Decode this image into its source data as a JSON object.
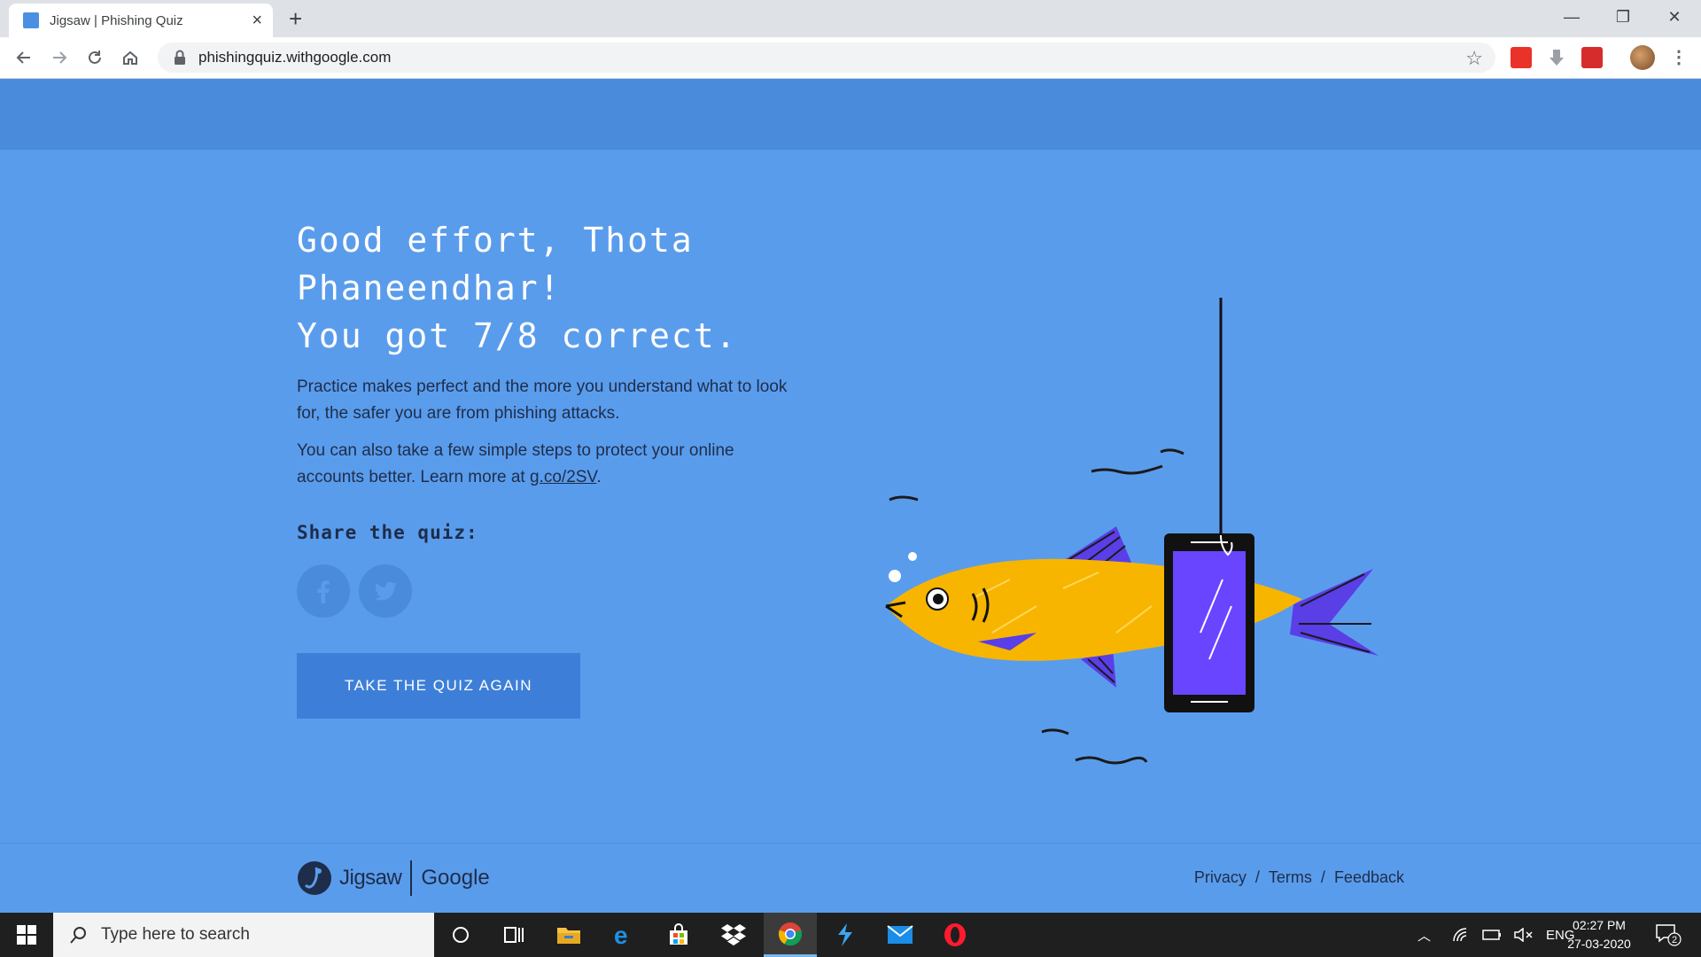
{
  "browser": {
    "tab_title": "Jigsaw | Phishing Quiz",
    "tab_close": "×",
    "new_tab": "+",
    "url": "phishingquiz.withgoogle.com",
    "controls": {
      "minimize": "—",
      "restore": "❐",
      "close": "✕"
    }
  },
  "result": {
    "line1": "Good effort, Thota",
    "line2": "Phaneendhar!",
    "line3": "You got 7/8 correct.",
    "para1": "Practice makes perfect and the more you understand what to look for, the safer you are from phishing attacks.",
    "para2_before": "You can also take a few simple steps to protect your online accounts better. Learn more at ",
    "para2_link": "g.co/2SV",
    "para2_after": ".",
    "share_label": "Share the quiz:",
    "retake_label": "TAKE THE QUIZ AGAIN"
  },
  "footer": {
    "brand_jigsaw": "Jigsaw",
    "brand_google": "Google",
    "links": {
      "privacy": "Privacy",
      "terms": "Terms",
      "feedback": "Feedback",
      "separator": "/"
    }
  },
  "taskbar": {
    "search_placeholder": "Type here to search",
    "language": "ENG",
    "time": "02:27 PM",
    "date": "27-03-2020",
    "notifications": "2"
  },
  "colors": {
    "page_bg": "#5a9cec",
    "band": "#4a8bdb",
    "button": "#3d7fd8",
    "fish": "#f7b500",
    "fin": "#5a3ee6",
    "phone_screen": "#6a45ff"
  },
  "icons": [
    "back-icon",
    "forward-icon",
    "reload-icon",
    "home-icon",
    "lock-icon",
    "star-icon",
    "facebook-icon",
    "twitter-icon",
    "windows-icon",
    "search-icon",
    "cortana-icon",
    "task-view-icon",
    "file-explorer-icon",
    "edge-icon",
    "store-icon",
    "dropbox-icon",
    "chrome-icon",
    "vscode-icon",
    "mail-icon",
    "opera-icon"
  ]
}
